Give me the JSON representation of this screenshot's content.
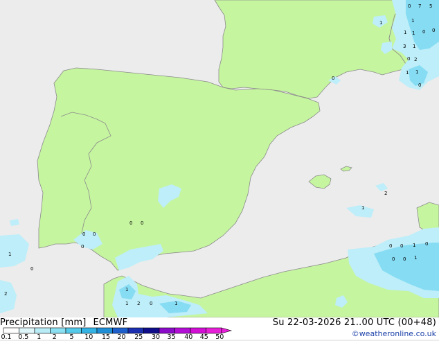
{
  "header": {
    "product": "Precipitation [mm]",
    "model": "ECMWF",
    "valid_time": "Su 22-03-2026 21..00 UTC (00+48)",
    "credit": "©weatheronline.co.uk"
  },
  "legend": {
    "ticks": [
      "0.1",
      "0.5",
      "1",
      "2",
      "5",
      "10",
      "15",
      "20",
      "25",
      "30",
      "35",
      "40",
      "45",
      "50"
    ],
    "colors": [
      "#ffffff",
      "#dff6fb",
      "#b8ecf6",
      "#8be0f2",
      "#55cbeb",
      "#33b4e4",
      "#1e8fd6",
      "#1d5fcb",
      "#1b2fb0",
      "#100d8a",
      "#8a0cc9",
      "#b30ed6",
      "#d30fd5",
      "#e71fd8"
    ]
  },
  "colors": {
    "land": "#c6f5a0",
    "sea": "#ececec",
    "border": "#8a8a8a",
    "precip_light": "#bdeef9",
    "precip_medium": "#86dcf3"
  },
  "map_labels": [
    "7",
    "5",
    "0",
    "1",
    "1",
    "1",
    "0",
    "0",
    "1",
    "3",
    "1",
    "0",
    "2",
    "1",
    "1",
    "0",
    "0",
    "0",
    "0",
    "0",
    "0",
    "0",
    "1",
    "0",
    "1",
    "2",
    "1",
    "2",
    "0",
    "1",
    "1",
    "2",
    "0",
    "0",
    "1",
    "0",
    "1",
    "0",
    "0"
  ]
}
